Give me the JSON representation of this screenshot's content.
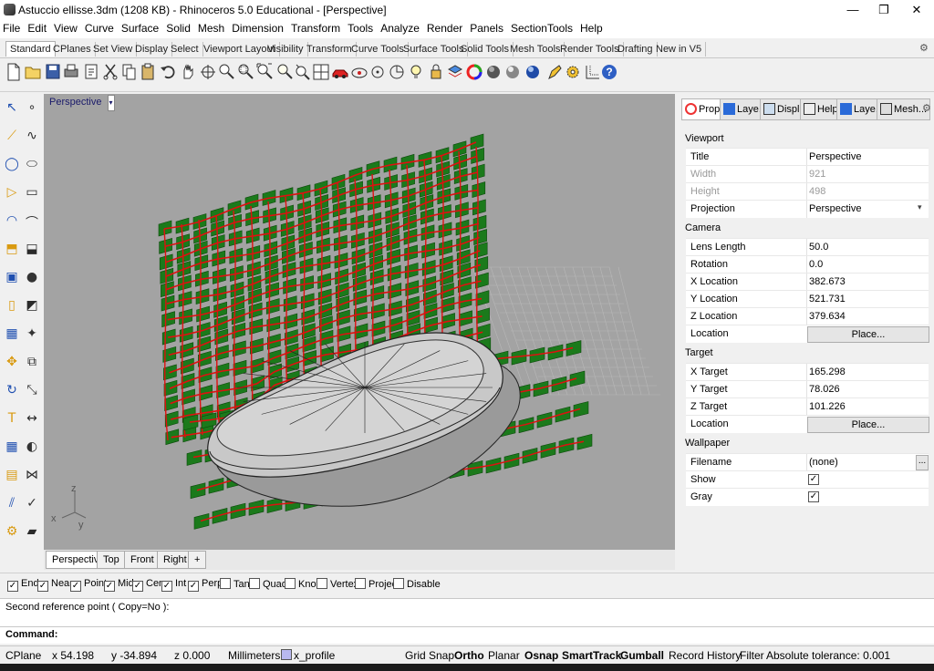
{
  "window": {
    "title": "Astuccio ellisse.3dm (1208 KB) - Rhinoceros 5.0 Educational - [Perspective]",
    "controls": [
      "—",
      "❐",
      "✕"
    ]
  },
  "menu": [
    "File",
    "Edit",
    "View",
    "Curve",
    "Surface",
    "Solid",
    "Mesh",
    "Dimension",
    "Transform",
    "Tools",
    "Analyze",
    "Render",
    "Panels",
    "SectionTools",
    "Help"
  ],
  "toolbar_tabs": [
    "Standard",
    "CPlanes",
    "Set View",
    "Display",
    "Select",
    "Viewport Layout",
    "Visibility",
    "Transform",
    "Curve Tools",
    "Surface Tools",
    "Solid Tools",
    "Mesh Tools",
    "Render Tools",
    "Drafting",
    "New in V5"
  ],
  "toolbar_icons": [
    "new-file",
    "open-file",
    "save",
    "print",
    "import",
    "cut",
    "copy",
    "paste",
    "undo",
    "pan",
    "rotate-view",
    "zoom-dynamic",
    "zoom-window",
    "zoom-extents",
    "zoom-selected",
    "zoom-target",
    "four-viewports",
    "car",
    "lock-view",
    "points-on",
    "circle-tool",
    "light-bulb",
    "lock",
    "layers",
    "color-wheel",
    "shaded-sphere",
    "rendered-sphere",
    "render-sphere",
    "pen-tool",
    "settings-gear",
    "grid",
    "help"
  ],
  "viewport": {
    "label": "Perspective",
    "tabs": [
      "Perspective",
      "Top",
      "Front",
      "Right",
      "+"
    ],
    "axes": {
      "z": "z",
      "x": "x",
      "y": "y"
    }
  },
  "panel": {
    "tabs": [
      "Prop...",
      "Laye...",
      "Displ...",
      "Help",
      "Laye...",
      "Mesh..."
    ],
    "sections": {
      "viewport": "Viewport",
      "camera": "Camera",
      "target": "Target",
      "wallpaper": "Wallpaper"
    },
    "viewport_rows": [
      {
        "label": "Title",
        "value": "Perspective"
      },
      {
        "label": "Width",
        "value": "921"
      },
      {
        "label": "Height",
        "value": "498"
      },
      {
        "label": "Projection",
        "value": "Perspective"
      }
    ],
    "camera_rows": [
      {
        "label": "Lens Length",
        "value": "50.0"
      },
      {
        "label": "Rotation",
        "value": "0.0"
      },
      {
        "label": "X Location",
        "value": "382.673"
      },
      {
        "label": "Y Location",
        "value": "521.731"
      },
      {
        "label": "Z Location",
        "value": "379.634"
      },
      {
        "label": "Location",
        "value": "Place..."
      }
    ],
    "target_rows": [
      {
        "label": "X Target",
        "value": "165.298"
      },
      {
        "label": "Y Target",
        "value": "78.026"
      },
      {
        "label": "Z Target",
        "value": "101.226"
      },
      {
        "label": "Location",
        "value": "Place..."
      }
    ],
    "wallpaper_rows": [
      {
        "label": "Filename",
        "value": "(none)",
        "button": "..."
      },
      {
        "label": "Show",
        "checked": true
      },
      {
        "label": "Gray",
        "checked": true
      }
    ]
  },
  "osnap": [
    {
      "label": "End",
      "checked": true
    },
    {
      "label": "Near",
      "checked": true
    },
    {
      "label": "Point",
      "checked": true
    },
    {
      "label": "Mid",
      "checked": true
    },
    {
      "label": "Cen",
      "checked": true
    },
    {
      "label": "Int",
      "checked": true
    },
    {
      "label": "Perp",
      "checked": true
    },
    {
      "label": "Tan",
      "checked": false
    },
    {
      "label": "Quad",
      "checked": false
    },
    {
      "label": "Knot",
      "checked": false
    },
    {
      "label": "Vertex",
      "checked": false
    },
    {
      "label": "Project",
      "checked": false
    },
    {
      "label": "Disable",
      "checked": false
    }
  ],
  "command": {
    "history": "Second reference point ( Copy=No ):",
    "prompt": "Command:",
    "value": ""
  },
  "status": {
    "cplane": "CPlane",
    "x": "x 54.198",
    "y": "y -34.894",
    "z": "z 0.000",
    "units": "Millimeters",
    "layer": "x_profile",
    "buttons": [
      "Grid Snap",
      "Ortho",
      "Planar",
      "Osnap",
      "SmartTrack",
      "Gumball",
      "Record History",
      "Filter"
    ],
    "tolerance": "Absolute tolerance: 0.001"
  },
  "colors": {
    "viewport_bg": "#a3a3a3",
    "fin_green": "#1b7a1b",
    "curve_red": "#e01010",
    "object_grey": "#c8c8c8"
  }
}
